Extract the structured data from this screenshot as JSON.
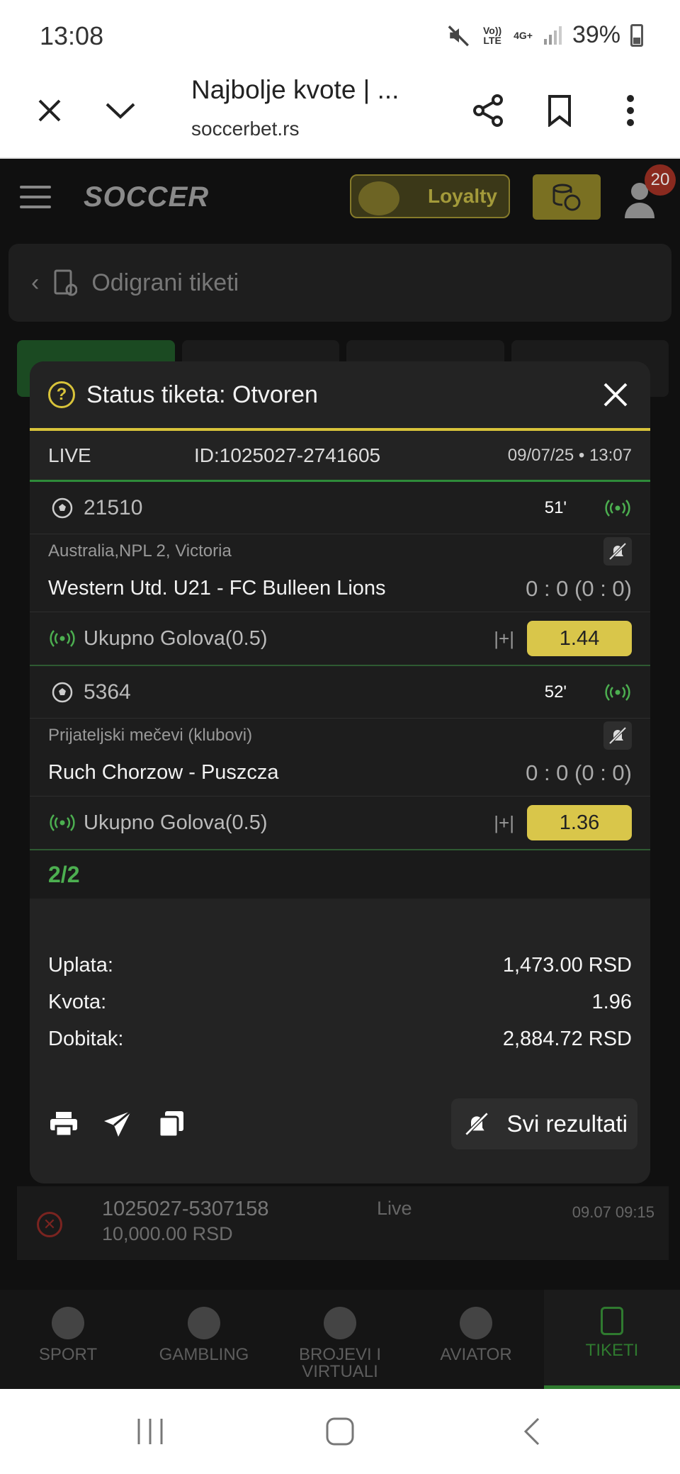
{
  "status_bar": {
    "time": "13:08",
    "volte": "Vo)) LTE",
    "network": "4G+",
    "battery": "39%"
  },
  "browser": {
    "title": "Najbolje kvote | ...",
    "url": "soccerbet.rs"
  },
  "site": {
    "logo": "SOCCER",
    "loyalty_label": "Loyalty",
    "notification_count": "20",
    "section_title": "Odigrani tiketi"
  },
  "modal": {
    "title": "Status tiketa: Otvoren",
    "ticket": {
      "type": "LIVE",
      "id": "ID:1025027-2741605",
      "datetime": "09/07/25 • 13:07"
    },
    "events": [
      {
        "code": "21510",
        "minute": "51'",
        "league": "Australia,NPL 2, Victoria",
        "teams": "Western Utd. U21 - FC Bulleen Lions",
        "score": "0 : 0 (0 : 0)",
        "market": "Ukupno Golova(0.5)",
        "symbol": "|+|",
        "odd": "1.44"
      },
      {
        "code": "5364",
        "minute": "52'",
        "league": "Prijateljski mečevi (klubovi)",
        "teams": "Ruch Chorzow - Puszcza",
        "score": "0 : 0 (0 : 0)",
        "market": "Ukupno Golova(0.5)",
        "symbol": "|+|",
        "odd": "1.36"
      }
    ],
    "count": "2/2",
    "summary": {
      "uplata_label": "Uplata:",
      "uplata_value": "1,473.00 RSD",
      "kvota_label": "Kvota:",
      "kvota_value": "1.96",
      "dobitak_label": "Dobitak:",
      "dobitak_value": "2,884.72 RSD"
    },
    "all_results_label": "Svi rezultati"
  },
  "background_ticket": {
    "id": "1025027-5307158",
    "amount": "10,000.00 RSD",
    "type": "Live",
    "date": "09.07 09:15"
  },
  "bottom_nav": [
    {
      "label": "SPORT"
    },
    {
      "label": "GAMBLING"
    },
    {
      "label": "BROJEVI I VIRTUALI"
    },
    {
      "label": "AVIATOR"
    },
    {
      "label": "TIKETI"
    }
  ]
}
